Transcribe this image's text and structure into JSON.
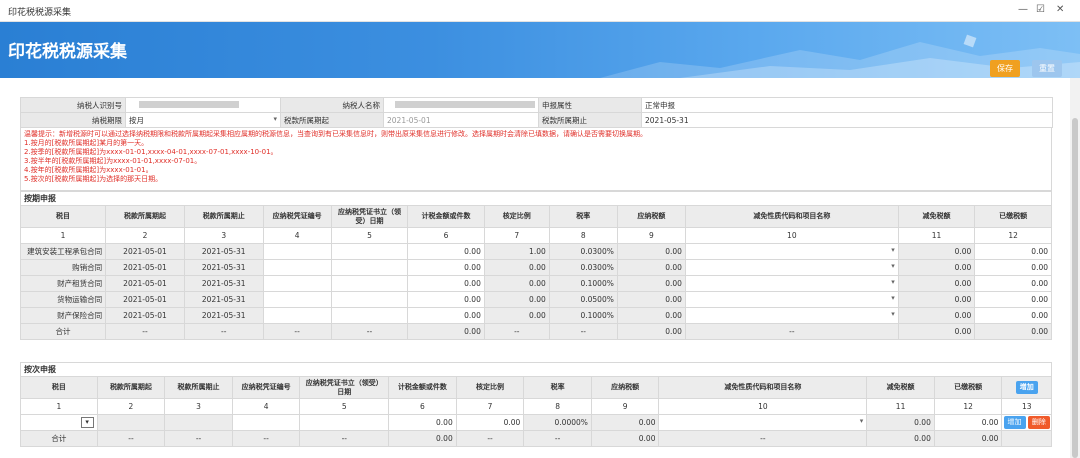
{
  "window": {
    "title": "印花税税源采集",
    "minimize": "—",
    "maximize": "☑",
    "close": "✕"
  },
  "banner": {
    "title": "印花税税源采集",
    "save": "保存",
    "reset": "重置"
  },
  "info": {
    "taxpayer_id_label": "纳税人识别号",
    "taxpayer_name_label": "纳税人名称",
    "declare_attr_label": "申报属性",
    "declare_attr_value": "正常申报",
    "period_label": "纳税期限",
    "period_value": "按月",
    "start_label": "税款所属期起",
    "start_value": "2021-05-01",
    "end_label": "税款所属期止",
    "end_value": "2021-05-31"
  },
  "notice": [
    "温馨提示：新增税源时可以通过选择纳税期限和税款所属期起采集相应属期的税源信息，当查询到有已采集信息时，则带出原采集信息进行修改。选择属期时会清除已填数据，请确认是否需要切换属期。",
    "1.按月的[税款所属期起]某月的第一天。",
    "2.按季的[税款所属期起]为xxxx-01-01,xxxx-04-01,xxxx-07-01,xxxx-10-01。",
    "3.按半年的[税款所属期起]为xxxx-01-01,xxxx-07-01。",
    "4.按年的[税款所属期起]为xxxx-01-01。",
    "5.按次的[税款所属期起]为选择的那天日期。"
  ],
  "periodic": {
    "section": "按期申报",
    "headers": [
      "税目",
      "税款所属期起",
      "税款所属期止",
      "应纳税凭证编号",
      "应纳税凭证书立（领受）日期",
      "计税金额或件数",
      "核定比例",
      "税率",
      "应纳税额",
      "减免性质代码和项目名称",
      "减免税额",
      "已缴税额"
    ],
    "numbers": [
      "1",
      "2",
      "3",
      "4",
      "5",
      "6",
      "7",
      "8",
      "9",
      "10",
      "11",
      "12"
    ],
    "rows": [
      [
        "建筑安装工程承包合同",
        "2021-05-01",
        "2021-05-31",
        "",
        "",
        "0.00",
        "1.00",
        "0.0300%",
        "0.00",
        "",
        "0.00",
        "0.00"
      ],
      [
        "购销合同",
        "2021-05-01",
        "2021-05-31",
        "",
        "",
        "0.00",
        "0.00",
        "0.0300%",
        "0.00",
        "",
        "0.00",
        "0.00"
      ],
      [
        "财产租赁合同",
        "2021-05-01",
        "2021-05-31",
        "",
        "",
        "0.00",
        "0.00",
        "0.1000%",
        "0.00",
        "",
        "0.00",
        "0.00"
      ],
      [
        "货物运输合同",
        "2021-05-01",
        "2021-05-31",
        "",
        "",
        "0.00",
        "0.00",
        "0.0500%",
        "0.00",
        "",
        "0.00",
        "0.00"
      ],
      [
        "财产保险合同",
        "2021-05-01",
        "2021-05-31",
        "",
        "",
        "0.00",
        "0.00",
        "0.1000%",
        "0.00",
        "",
        "0.00",
        "0.00"
      ]
    ],
    "total": [
      "合计",
      "--",
      "--",
      "--",
      "--",
      "0.00",
      "--",
      "--",
      "0.00",
      "--",
      "0.00",
      "0.00"
    ]
  },
  "per_time": {
    "section": "按次申报",
    "headers": [
      "税目",
      "税款所属期起",
      "税款所属期止",
      "应纳税凭证编号",
      "应纳税凭证书立（领受）日期",
      "计税金额或件数",
      "核定比例",
      "税率",
      "应纳税额",
      "减免性质代码和项目名称",
      "减免税额",
      "已缴税额"
    ],
    "numbers": [
      "1",
      "2",
      "3",
      "4",
      "5",
      "6",
      "7",
      "8",
      "9",
      "10",
      "11",
      "12",
      "13"
    ],
    "add": "增加",
    "delete": "删除",
    "row": [
      "",
      "",
      "",
      "",
      "",
      "0.00",
      "0.00",
      "0.0000%",
      "0.00",
      "",
      "0.00",
      "0.00"
    ],
    "total": [
      "合计",
      "--",
      "--",
      "--",
      "--",
      "0.00",
      "--",
      "--",
      "0.00",
      "--",
      "0.00",
      "0.00"
    ]
  }
}
